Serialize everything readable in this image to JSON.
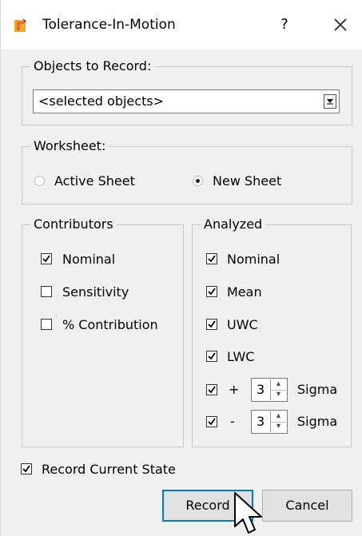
{
  "window": {
    "title": "Tolerance-In-Motion",
    "help_label": "?",
    "close_icon": "close-icon",
    "app_icon": "tolerance-app-icon"
  },
  "objects_group": {
    "legend": "Objects to Record:",
    "combo_value": "<selected objects>"
  },
  "worksheet_group": {
    "legend": "Worksheet:",
    "options": [
      {
        "label": "Active Sheet",
        "selected": false
      },
      {
        "label": "New Sheet",
        "selected": true
      }
    ]
  },
  "contributors_group": {
    "legend": "Contributors",
    "items": [
      {
        "label": "Nominal",
        "checked": true
      },
      {
        "label": "Sensitivity",
        "checked": false
      },
      {
        "label": "% Contribution",
        "checked": false
      }
    ]
  },
  "analyzed_group": {
    "legend": "Analyzed",
    "items": [
      {
        "label": "Nominal",
        "checked": true
      },
      {
        "label": "Mean",
        "checked": true
      },
      {
        "label": "UWC",
        "checked": true
      },
      {
        "label": "LWC",
        "checked": true
      }
    ],
    "sigma_rows": [
      {
        "sign": "+",
        "value": "3",
        "label": "Sigma",
        "checked": true
      },
      {
        "sign": "-",
        "value": "3",
        "label": "Sigma",
        "checked": true
      }
    ]
  },
  "record_current_state": {
    "label": "Record Current State",
    "checked": true
  },
  "buttons": {
    "record": "Record",
    "cancel": "Cancel"
  },
  "colors": {
    "accent": "#0078d7",
    "app_icon": "#f5a623"
  }
}
